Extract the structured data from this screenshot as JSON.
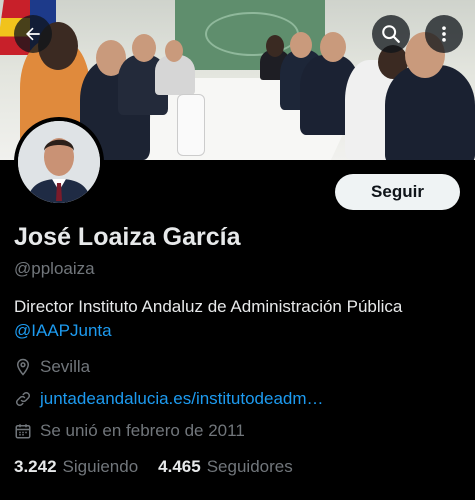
{
  "profile": {
    "name": "José Loaiza García",
    "handle": "@pploaiza",
    "bio": "Director Instituto Andaluz de Administración Pública",
    "bio_mention": "@IAAPJunta",
    "location": "Sevilla",
    "website": "juntadeandalucia.es/institutodeadm…",
    "joined": "Se unió en febrero de 2011"
  },
  "actions": {
    "follow_label": "Seguir"
  },
  "stats": {
    "following_count": "3.242",
    "following_label": "Siguiendo",
    "followers_count": "4.465",
    "followers_label": "Seguidores"
  },
  "icons": {
    "back": "arrow-left-icon",
    "search": "search-icon",
    "more": "more-vertical-icon",
    "location": "location-pin-icon",
    "link": "link-icon",
    "calendar": "calendar-icon"
  },
  "colors": {
    "accent": "#1d9bf0",
    "background": "#000000",
    "secondary_text": "#71767b"
  }
}
